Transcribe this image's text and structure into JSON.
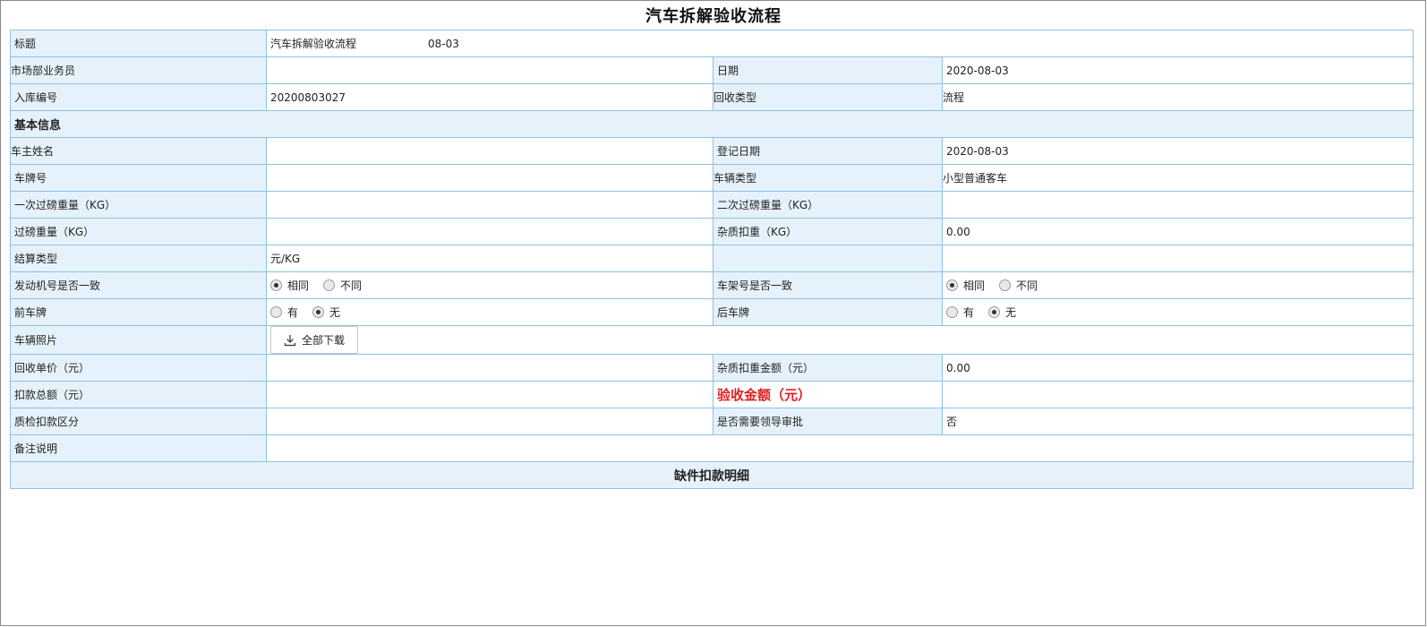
{
  "page_title": "汽车拆解验收流程",
  "title_row": {
    "label": "标题",
    "value": "汽车拆解验收流程",
    "suffix": "08-03"
  },
  "row_salesman": {
    "label": "市场部业务员",
    "value": "",
    "label2": "日期",
    "value2": "2020-08-03"
  },
  "row_stock_no": {
    "label": "入库编号",
    "value": "20200803027",
    "label2": "回收类型",
    "value2": "流程"
  },
  "section_basic": "基本信息",
  "row_owner": {
    "label": "车主姓名",
    "value": "",
    "label2": "登记日期",
    "value2": "2020-08-03"
  },
  "row_plate": {
    "label": "车牌号",
    "value": "",
    "label2": "车辆类型",
    "value2": "小型普通客车"
  },
  "row_weigh": {
    "label": "一次过磅重量（KG）",
    "value": "",
    "label2": "二次过磅重量（KG）",
    "value2": ""
  },
  "row_net": {
    "label": "过磅重量（KG）",
    "value": "",
    "label2": "杂质扣重（KG）",
    "value2": "0.00"
  },
  "row_settle": {
    "label": "结算类型",
    "value": "元/KG",
    "label2": "",
    "value2": ""
  },
  "row_engine": {
    "label": "发动机号是否一致",
    "opt_same": "相同",
    "opt_diff": "不同",
    "label2": "车架号是否一致",
    "opt2_same": "相同",
    "opt2_diff": "不同"
  },
  "row_plates": {
    "label": "前车牌",
    "opt_yes": "有",
    "opt_no": "无",
    "label2": "后车牌",
    "opt2_yes": "有",
    "opt2_no": "无"
  },
  "row_photo": {
    "label": "车辆照片",
    "download_label": "全部下载"
  },
  "row_price": {
    "label": "回收单价（元）",
    "value": "",
    "label2": "杂质扣重金额（元）",
    "value2": "0.00"
  },
  "row_deduct": {
    "label": "扣款总额（元）",
    "value": "",
    "label2": "验收金额（元）",
    "value2": ""
  },
  "row_qc": {
    "label": "质检扣款区分",
    "value": "",
    "label2": "是否需要领导审批",
    "value2": "否"
  },
  "row_remark": {
    "label": "备注说明",
    "value": ""
  },
  "section_missing": "缺件扣款明细",
  "colors": {
    "border": "#8ec0e2",
    "label_bg": "#e6f2fb",
    "alert_red": "#e02020"
  }
}
